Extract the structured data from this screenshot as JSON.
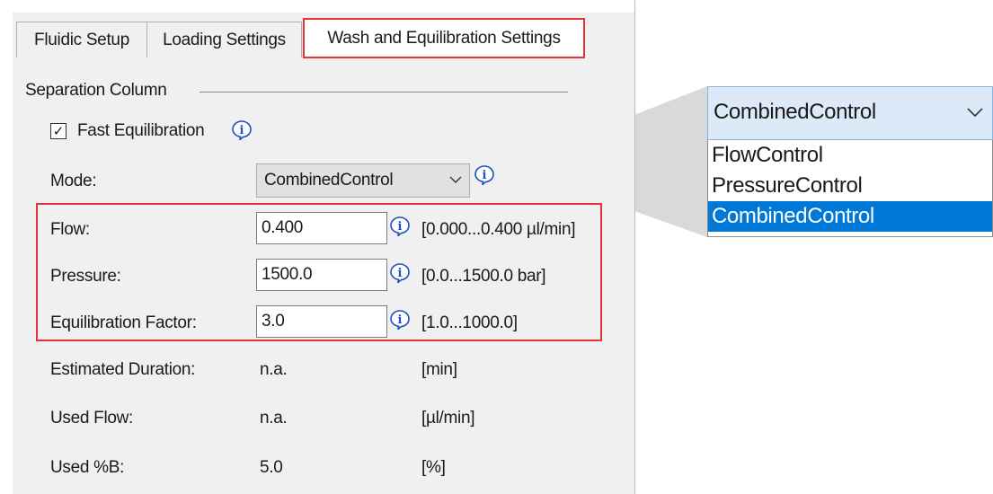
{
  "tabs": [
    {
      "label": "Fluidic Setup"
    },
    {
      "label": "Loading Settings"
    },
    {
      "label": "Wash and Equilibration Settings"
    }
  ],
  "group": {
    "label": "Separation Column"
  },
  "fast_equilibration": {
    "label": "Fast Equilibration",
    "checked": true
  },
  "mode": {
    "label": "Mode:",
    "value": "CombinedControl"
  },
  "flow": {
    "label": "Flow:",
    "value": "0.400",
    "range": "[0.000...0.400 µl/min]"
  },
  "pressure": {
    "label": "Pressure:",
    "value": "1500.0",
    "range": "[0.0...1500.0 bar]"
  },
  "equilibration_factor": {
    "label": "Equilibration Factor:",
    "value": "3.0",
    "range": "[1.0...1000.0]"
  },
  "estimated_duration": {
    "label": "Estimated Duration:",
    "value": "n.a.",
    "unit": "[min]"
  },
  "used_flow": {
    "label": "Used Flow:",
    "value": "n.a.",
    "unit": "[µl/min]"
  },
  "used_b": {
    "label": "Used %B:",
    "value": "5.0",
    "unit": "[%]"
  },
  "dropdown": {
    "selected": "CombinedControl",
    "options": [
      "FlowControl",
      "PressureControl",
      "CombinedControl"
    ]
  },
  "colors": {
    "highlight": "#e53238",
    "selection": "#0078d7",
    "info_icon": "#1f4fc4"
  },
  "icons": {
    "info": "info-icon",
    "chevron": "chevron-down-icon",
    "check": "checkmark-icon"
  }
}
